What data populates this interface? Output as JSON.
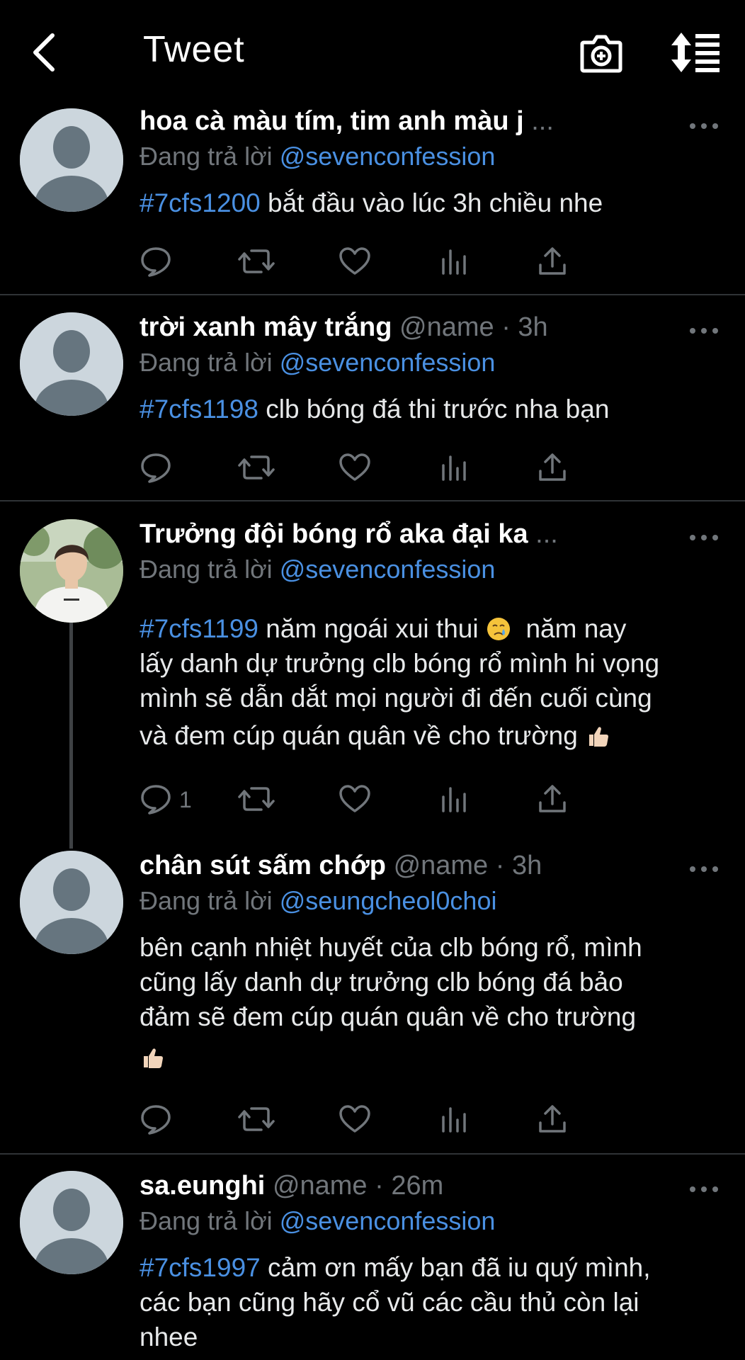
{
  "header": {
    "title": "Tweet"
  },
  "tweets": [
    {
      "name": "hoa cà màu tím, tim anh màu j",
      "name_suffix": "...",
      "handle": "",
      "time": "",
      "reply_prefix": "Đang trả lời",
      "reply_to": "@sevenconfession",
      "tag": "#7cfs1200",
      "text": "bắt đầu vào lúc 3h chiều nhe",
      "reply_count": ""
    },
    {
      "name": "trời xanh mây trắng",
      "handle": "@name",
      "time": "· 3h",
      "reply_prefix": "Đang trả lời",
      "reply_to": "@sevenconfession",
      "tag": "#7cfs1198",
      "text": "clb bóng đá thi trước nha bạn",
      "reply_count": ""
    },
    {
      "name": "Trưởng đội bóng rổ aka đại ka",
      "name_suffix": "...",
      "handle": "",
      "time": "",
      "reply_prefix": "Đang trả lời",
      "reply_to": "@sevenconfession",
      "tag": "#7cfs1199",
      "text_lines": [
        "năm ngoái xui thui",
        "năm nay",
        "lấy danh dự trưởng clb bóng rổ mình hi vọng",
        "mình sẽ dẫn dắt mọi người đi đến cuối cùng",
        "và đem cúp quán quân về cho trường"
      ],
      "reply_count": "1"
    },
    {
      "name": "chân sút sấm chớp",
      "handle": "@name",
      "time": "· 3h",
      "reply_prefix": "Đang trả lời",
      "reply_to": "@seungcheol0choi",
      "tag": "",
      "text_lines": [
        "bên cạnh nhiệt huyết của clb bóng rổ, mình",
        "cũng lấy danh dự trưởng clb bóng đá bảo",
        "đảm sẽ đem cúp quán quân về cho trường"
      ],
      "reply_count": ""
    },
    {
      "name": "sa.eunghi",
      "handle": "@name",
      "time": "· 26m",
      "reply_prefix": "Đang trả lời",
      "reply_to": "@sevenconfession",
      "tag": "#7cfs1997",
      "text_lines": [
        "cảm ơn mấy bạn đã iu quý mình,",
        "các bạn cũng hãy cổ vũ các cầu thủ còn lại",
        "nhee"
      ],
      "reply_count": ""
    }
  ],
  "icons": {
    "back": "chevron-left-icon",
    "camera": "camera-plus-icon",
    "sort": "sort-icon",
    "reply": "comment-icon",
    "retweet": "retweet-icon",
    "like": "heart-icon",
    "views": "bar-chart-icon",
    "share": "share-icon",
    "more": "more-horizontal-icon"
  },
  "colors": {
    "background": "#000000",
    "link": "#4a90e2",
    "muted": "#71767b",
    "text": "#e7e9ea"
  }
}
